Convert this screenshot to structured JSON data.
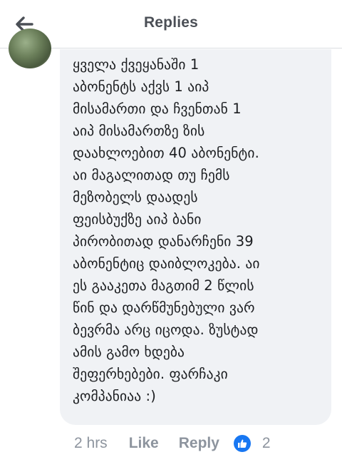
{
  "header": {
    "title": "Replies",
    "back_icon": "arrow-left-icon"
  },
  "comment": {
    "text": "ყველა ქვეყანაში 1\nაბონენტს აქვს 1 აიპ\nმისამართი და ჩვენთან 1\nაიპ მისამართზე ზის\nდაახლოებით 40 აბონენტი.\nაი მაგალითად თუ ჩემს\nმეზობელს დაადეს\nფეისბუქზე აიპ ბანი\nპირობითად დანარჩენი 39\nაბონენტიც დაიბლოკება. აი\nეს გააკეთა მაგთიმ 2 წლის\nწინ და დარწმუნებული ვარ\nბევრმა არც იცოდა. ზუსტად\nამის გამო ხდება\nშეფერხებები. ფარჩაკი\nკომპანიაა :)"
  },
  "actions": {
    "time": "2 hrs",
    "like_label": "Like",
    "reply_label": "Reply",
    "reaction_count": "2",
    "reaction_icon": "thumbs-up-icon"
  },
  "colors": {
    "accent": "#1877f2",
    "bubble": "#f0f2f5",
    "muted": "#8d949e"
  }
}
